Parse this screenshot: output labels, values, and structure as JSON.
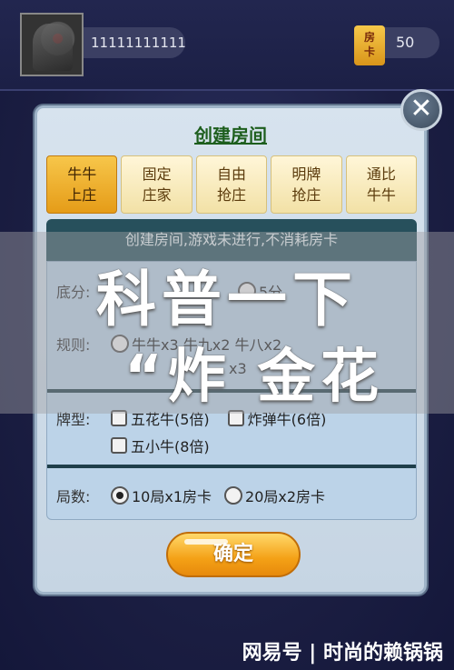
{
  "header": {
    "user_id": "11111111111",
    "card_icon_label": "房\n卡",
    "card_count": "50"
  },
  "dialog": {
    "title": "创建房间",
    "close_symbol": "✕",
    "tabs": [
      {
        "line1": "牛牛",
        "line2": "上庄",
        "active": true
      },
      {
        "line1": "固定",
        "line2": "庄家",
        "active": false
      },
      {
        "line1": "自由",
        "line2": "抢庄",
        "active": false
      },
      {
        "line1": "明牌",
        "line2": "抢庄",
        "active": false
      },
      {
        "line1": "通比",
        "line2": "牛牛",
        "active": false
      }
    ],
    "notice": "创建房间,游戏未进行,不消耗房卡",
    "rows": {
      "base_label": "底分:",
      "base_option": "5分",
      "rule_label": "规则:",
      "rule_option1": "牛牛x3 牛九x2 牛八x2",
      "rule_option2": "x3",
      "type_label": "牌型:",
      "type_opt1": "五花牛(5倍)",
      "type_opt2": "炸弹牛(6倍)",
      "type_opt3": "五小牛(8倍)",
      "rounds_label": "局数:",
      "round_opt1": "10局x1房卡",
      "round_opt2": "20局x2房卡"
    },
    "confirm_label": "确定"
  },
  "watermark": {
    "line1": "科普一下",
    "line2": "“炸 金花"
  },
  "footer": "网易号 | 时尚的赖锅锅"
}
